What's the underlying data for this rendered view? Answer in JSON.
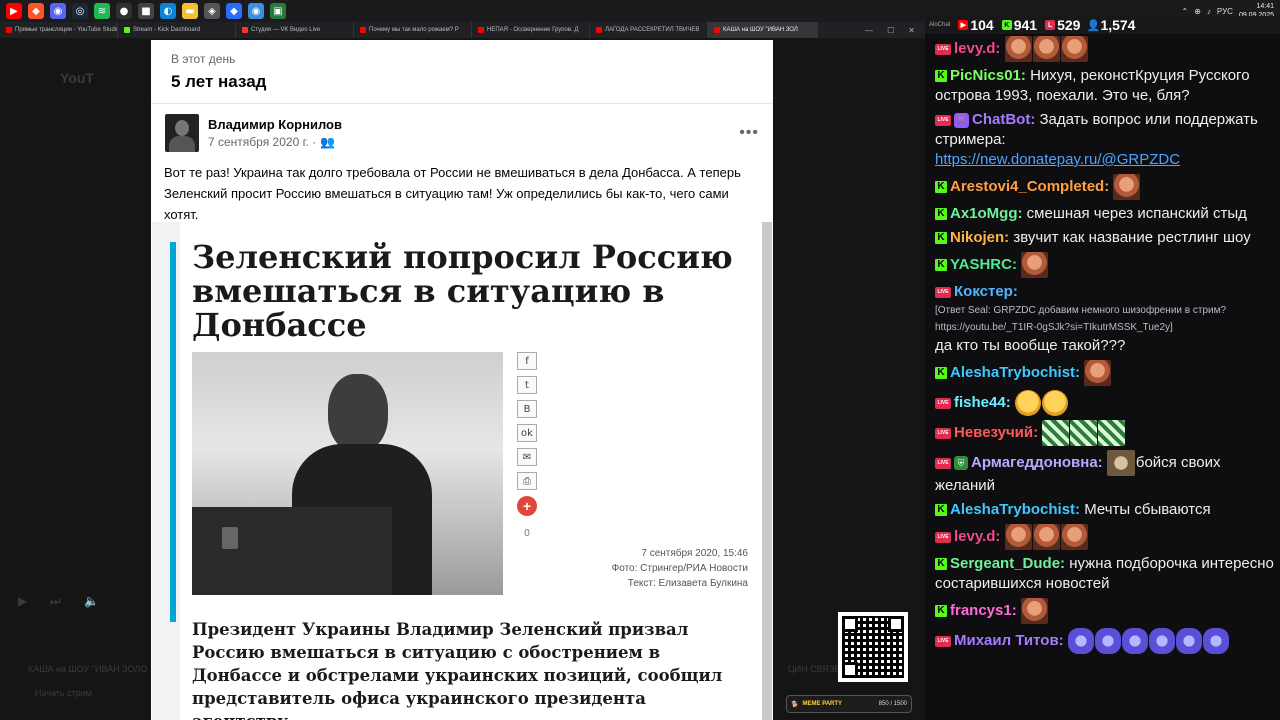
{
  "taskbar": {
    "icons": [
      {
        "name": "youtube-icon",
        "color": "#ff0000",
        "glyph": "▶"
      },
      {
        "name": "brave-icon",
        "color": "#fb542b",
        "glyph": "◆"
      },
      {
        "name": "discord-icon",
        "color": "#5865f2",
        "glyph": "◉"
      },
      {
        "name": "steam-icon",
        "color": "#1b2838",
        "glyph": "◎"
      },
      {
        "name": "spotify-icon",
        "color": "#1db954",
        "glyph": "≋"
      },
      {
        "name": "obs-icon",
        "color": "#302e31",
        "glyph": "●"
      },
      {
        "name": "app-icon",
        "color": "#444444",
        "glyph": "■"
      },
      {
        "name": "edge-icon",
        "color": "#0a84d6",
        "glyph": "◐"
      },
      {
        "name": "folder-icon",
        "color": "#f1c232",
        "glyph": "▬"
      },
      {
        "name": "app-icon",
        "color": "#555555",
        "glyph": "◈"
      },
      {
        "name": "app-icon",
        "color": "#2b6cff",
        "glyph": "◆"
      },
      {
        "name": "app-icon",
        "color": "#3a8fd8",
        "glyph": "◉"
      },
      {
        "name": "app-icon",
        "color": "#2a7a3a",
        "glyph": "▣"
      }
    ],
    "lang": "РУС",
    "time": "14:41",
    "date": "09.09.2025"
  },
  "browser_tabs": [
    {
      "label": "Прямые трансляции - YouTube Studio",
      "color": "#ff0000",
      "active": false
    },
    {
      "label": "Stream - Kick Dashboard",
      "color": "#53fc18",
      "active": false
    },
    {
      "label": "Студия — VK Видео Live",
      "color": "#ff3333",
      "active": false
    },
    {
      "label": "Почему мы так мало рожаем? Р",
      "color": "#ff0000",
      "active": false
    },
    {
      "label": "НЕПАЯ - Оссвернение Групов. Д",
      "color": "#ff0000",
      "active": false
    },
    {
      "label": "ЛАГОДА РАССЕКРЕТИЛ ТВИЧЕВ",
      "color": "#ff0000",
      "active": false
    },
    {
      "label": "КАША на ШОУ \"ИВАН ЗОЛ",
      "color": "#ff0000",
      "active": true
    }
  ],
  "background": {
    "ghost_brand": "YouT",
    "ghost_title": "КАША на ШОУ \"ИВАН ЗОЛО",
    "ghost_sub": "Начать стрим",
    "ghost_right": "ЦИН СВЯЗЕ"
  },
  "facebook": {
    "on_this_day": "В этот день",
    "years_ago": "5 лет назад",
    "author": "Владимир Корнилов",
    "date": "7 сентября 2020 г. ·",
    "post_text": "Вот те раз! Украина так долго требовала от России не вмешиваться в дела Донбасса. А теперь Зеленский просит Россию вмешаться в ситуацию там! Уж определились бы как-то, чего сами хотят.",
    "article": {
      "title": "Зеленский попросил Россию вмешаться в ситуацию в Донбассе",
      "share_buttons": [
        {
          "name": "facebook-icon",
          "glyph": "f"
        },
        {
          "name": "twitter-icon",
          "glyph": "t"
        },
        {
          "name": "vk-icon",
          "glyph": "B"
        },
        {
          "name": "ok-icon",
          "glyph": "ok"
        },
        {
          "name": "mail-icon",
          "glyph": "✉"
        },
        {
          "name": "print-icon",
          "glyph": "⎙"
        }
      ],
      "share_count": "0",
      "meta_date": "7 сентября 2020, 15:46",
      "meta_photo": "Фото: Стрингер/РИА Новости",
      "meta_text": "Текст: Елизавета Булкина",
      "lead": "Президент Украины Владимир Зеленский призвал Россию вмешаться в ситуацию с обострением в Донбассе и обстрелами украинских позиций, сообщил представитель офиса украинского президента агентству."
    }
  },
  "meme_party": {
    "label": "MEME PARTY",
    "count": "850 / 1500"
  },
  "chat_header": {
    "app": "AloChat",
    "youtube_viewers": "104",
    "kick_viewers": "941",
    "vk_viewers": "529",
    "total_viewers": "1,574"
  },
  "chat": [
    {
      "platform": "live",
      "user": "levy.d:",
      "color": "#f24b8c",
      "text": "",
      "emotes": [
        "face",
        "face",
        "face"
      ]
    },
    {
      "platform": "kick",
      "user": "PicNics01:",
      "color": "#7cff60",
      "text": "Нихуя, реконстКруция Русского острова 1993, поехали. Это че, бля?",
      "emotes": []
    },
    {
      "platform": "live-bot",
      "user": "ChatBot:",
      "color": "#a77bff",
      "text": "Задать вопрос или поддержать стримера:",
      "link": "https://new.donatepay.ru/@GRPZDC",
      "emotes": []
    },
    {
      "platform": "kick",
      "user": "Arestovi4_Completed:",
      "color": "#ffa040",
      "text": "",
      "emotes": [
        "face"
      ]
    },
    {
      "platform": "kick",
      "user": "Ax1oMgg:",
      "color": "#6ff09a",
      "text": "смешная через испанский стыд",
      "emotes": []
    },
    {
      "platform": "kick",
      "user": "Nikojen:",
      "color": "#ffb347",
      "text": "звучит как название рестлинг шоу",
      "emotes": []
    },
    {
      "platform": "kick",
      "user": "YASHRC:",
      "color": "#50e890",
      "text": "",
      "emotes": [
        "face"
      ]
    },
    {
      "platform": "live",
      "user": "Кокстер:",
      "color": "#4fb6ff",
      "text": "да кто ты вообще такой???",
      "reply": "[Ответ Seal: GRPZDC добавим немного шизофрении в стрим? https://youtu.be/_T1IR-0gSJk?si=TIkutrMSSK_Tue2y]",
      "emotes": []
    },
    {
      "platform": "kick",
      "user": "AleshaTrybochist:",
      "color": "#41c7ff",
      "text": "",
      "emotes": [
        "face"
      ]
    },
    {
      "platform": "live",
      "user": "fishe44:",
      "color": "#6cf0ff",
      "text": "",
      "emotes": [
        "laugh",
        "laugh"
      ]
    },
    {
      "platform": "live",
      "user": "Невезучий:",
      "color": "#ff5a5a",
      "text": "",
      "emotes": [
        "green",
        "green",
        "green"
      ]
    },
    {
      "platform": "live-shield",
      "user": "Армагеддоновна:",
      "color": "#bda6ff",
      "text": "бойся своих желаний",
      "emotes": [
        "cat"
      ]
    },
    {
      "platform": "kick",
      "user": "AleshaTrybochist:",
      "color": "#41c7ff",
      "text": "Мечты сбываются",
      "emotes": []
    },
    {
      "platform": "live",
      "user": "levy.d:",
      "color": "#f24b8c",
      "text": "",
      "emotes": [
        "face",
        "face",
        "face"
      ]
    },
    {
      "platform": "kick",
      "user": "Sergeant_Dude:",
      "color": "#6ff09a",
      "text": "нужна подборочка интересно состарившихся новостей",
      "emotes": []
    },
    {
      "platform": "kick",
      "user": "francys1:",
      "color": "#ff6bd6",
      "text": "",
      "emotes": [
        "face"
      ]
    },
    {
      "platform": "live",
      "user": "Михаил Титов:",
      "color": "#a77bff",
      "text": "",
      "emotes": [
        "monster",
        "monster",
        "monster",
        "monster",
        "monster",
        "monster"
      ]
    }
  ]
}
